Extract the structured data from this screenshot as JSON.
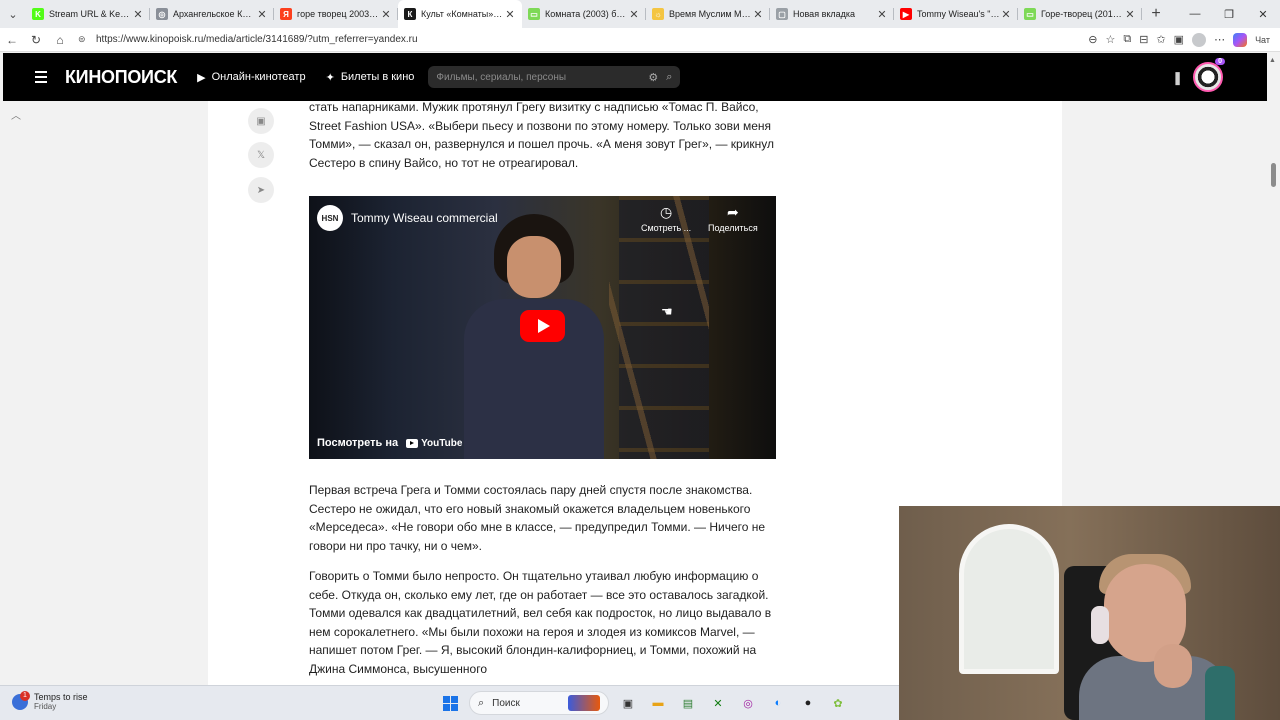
{
  "browser": {
    "tabs": [
      {
        "label": "Stream URL & Key - Kick",
        "fav_color": "#53fc18",
        "fav_glyph": "K",
        "active": false
      },
      {
        "label": "Архангельское Колесо",
        "fav_color": "#8a8f98",
        "fav_glyph": "◎",
        "active": false
      },
      {
        "label": "горе творец 2003 — Ян",
        "fav_color": "#fc3f1d",
        "fav_glyph": "Я",
        "active": false
      },
      {
        "label": "Культ «Комнаты»: как Т",
        "fav_color": "#1a1a1a",
        "fav_glyph": "К",
        "active": true
      },
      {
        "label": "Комната (2003) бесплат",
        "fav_color": "#7ed957",
        "fav_glyph": "▭",
        "active": false
      },
      {
        "label": "Время Муслим Магома",
        "fav_color": "#f4c542",
        "fav_glyph": "☼",
        "active": false
      },
      {
        "label": "Новая вкладка",
        "fav_color": "#9aa0a6",
        "fav_glyph": "▢",
        "active": false
      },
      {
        "label": "Tommy Wiseau's \"The D",
        "fav_color": "#ff0000",
        "fav_glyph": "▶",
        "active": false
      },
      {
        "label": "Горе-творец (2017) см",
        "fav_color": "#7ed957",
        "fav_glyph": "▭",
        "active": false
      }
    ],
    "url": "https://www.kinopoisk.ru/media/article/3141689/?utm_referrer=yandex.ru",
    "chat_label": "Чат"
  },
  "kp": {
    "logo": "КИНОПОИСК",
    "nav_online": "Онлайн-кинотеатр",
    "nav_tickets": "Билеты в кино",
    "search_placeholder": "Фильмы, сериалы, персоны",
    "avatar_badge": "0"
  },
  "article": {
    "para_top": "стать напарниками. Мужик протянул Грегу визитку с надписью «Томас П. Вайсо, Street Fashion USA». «Выбери пьесу и позвони по этому номеру. Только зови меня Томми», — сказал он, развернулся и пошел прочь. «А меня зовут Грег», — крикнул Сестеро в спину Вайсо, но тот не отреагировал.",
    "video": {
      "channel": "HSN",
      "title": "Tommy Wiseau commercial",
      "watch_later": "Смотреть ...",
      "share": "Поделиться",
      "watch_on": "Посмотреть на",
      "youtube": "YouTube"
    },
    "para_1": "Первая встреча Грега и Томми состоялась пару дней спустя после знакомства. Сестеро не ожидал, что его новый знакомый окажется владельцем новенького «Мерседеса». «Не говори обо мне в классе, — предупредил Томми. — Ничего не говори ни про тачку, ни о чем».",
    "para_2": "Говорить о Томми было непросто. Он тщательно утаивал любую информацию о себе. Откуда он, сколько ему лет, где он работает — все это оставалось загадкой. Томми одевался как двадцатилетний, вел себя как подросток, но лицо выдавало в нем сорокалетнего. «Мы были похожи на героя и злодея из комиксов Marvel, — напишет потом Грег. — Я, высокий блондин-калифорниец, и Томми, похожий на Джина Симмонса, высушенного"
  },
  "taskbar": {
    "weather_title": "Temps to rise",
    "weather_sub": "Friday",
    "weather_badge": "1",
    "search_label": "Поиск"
  }
}
